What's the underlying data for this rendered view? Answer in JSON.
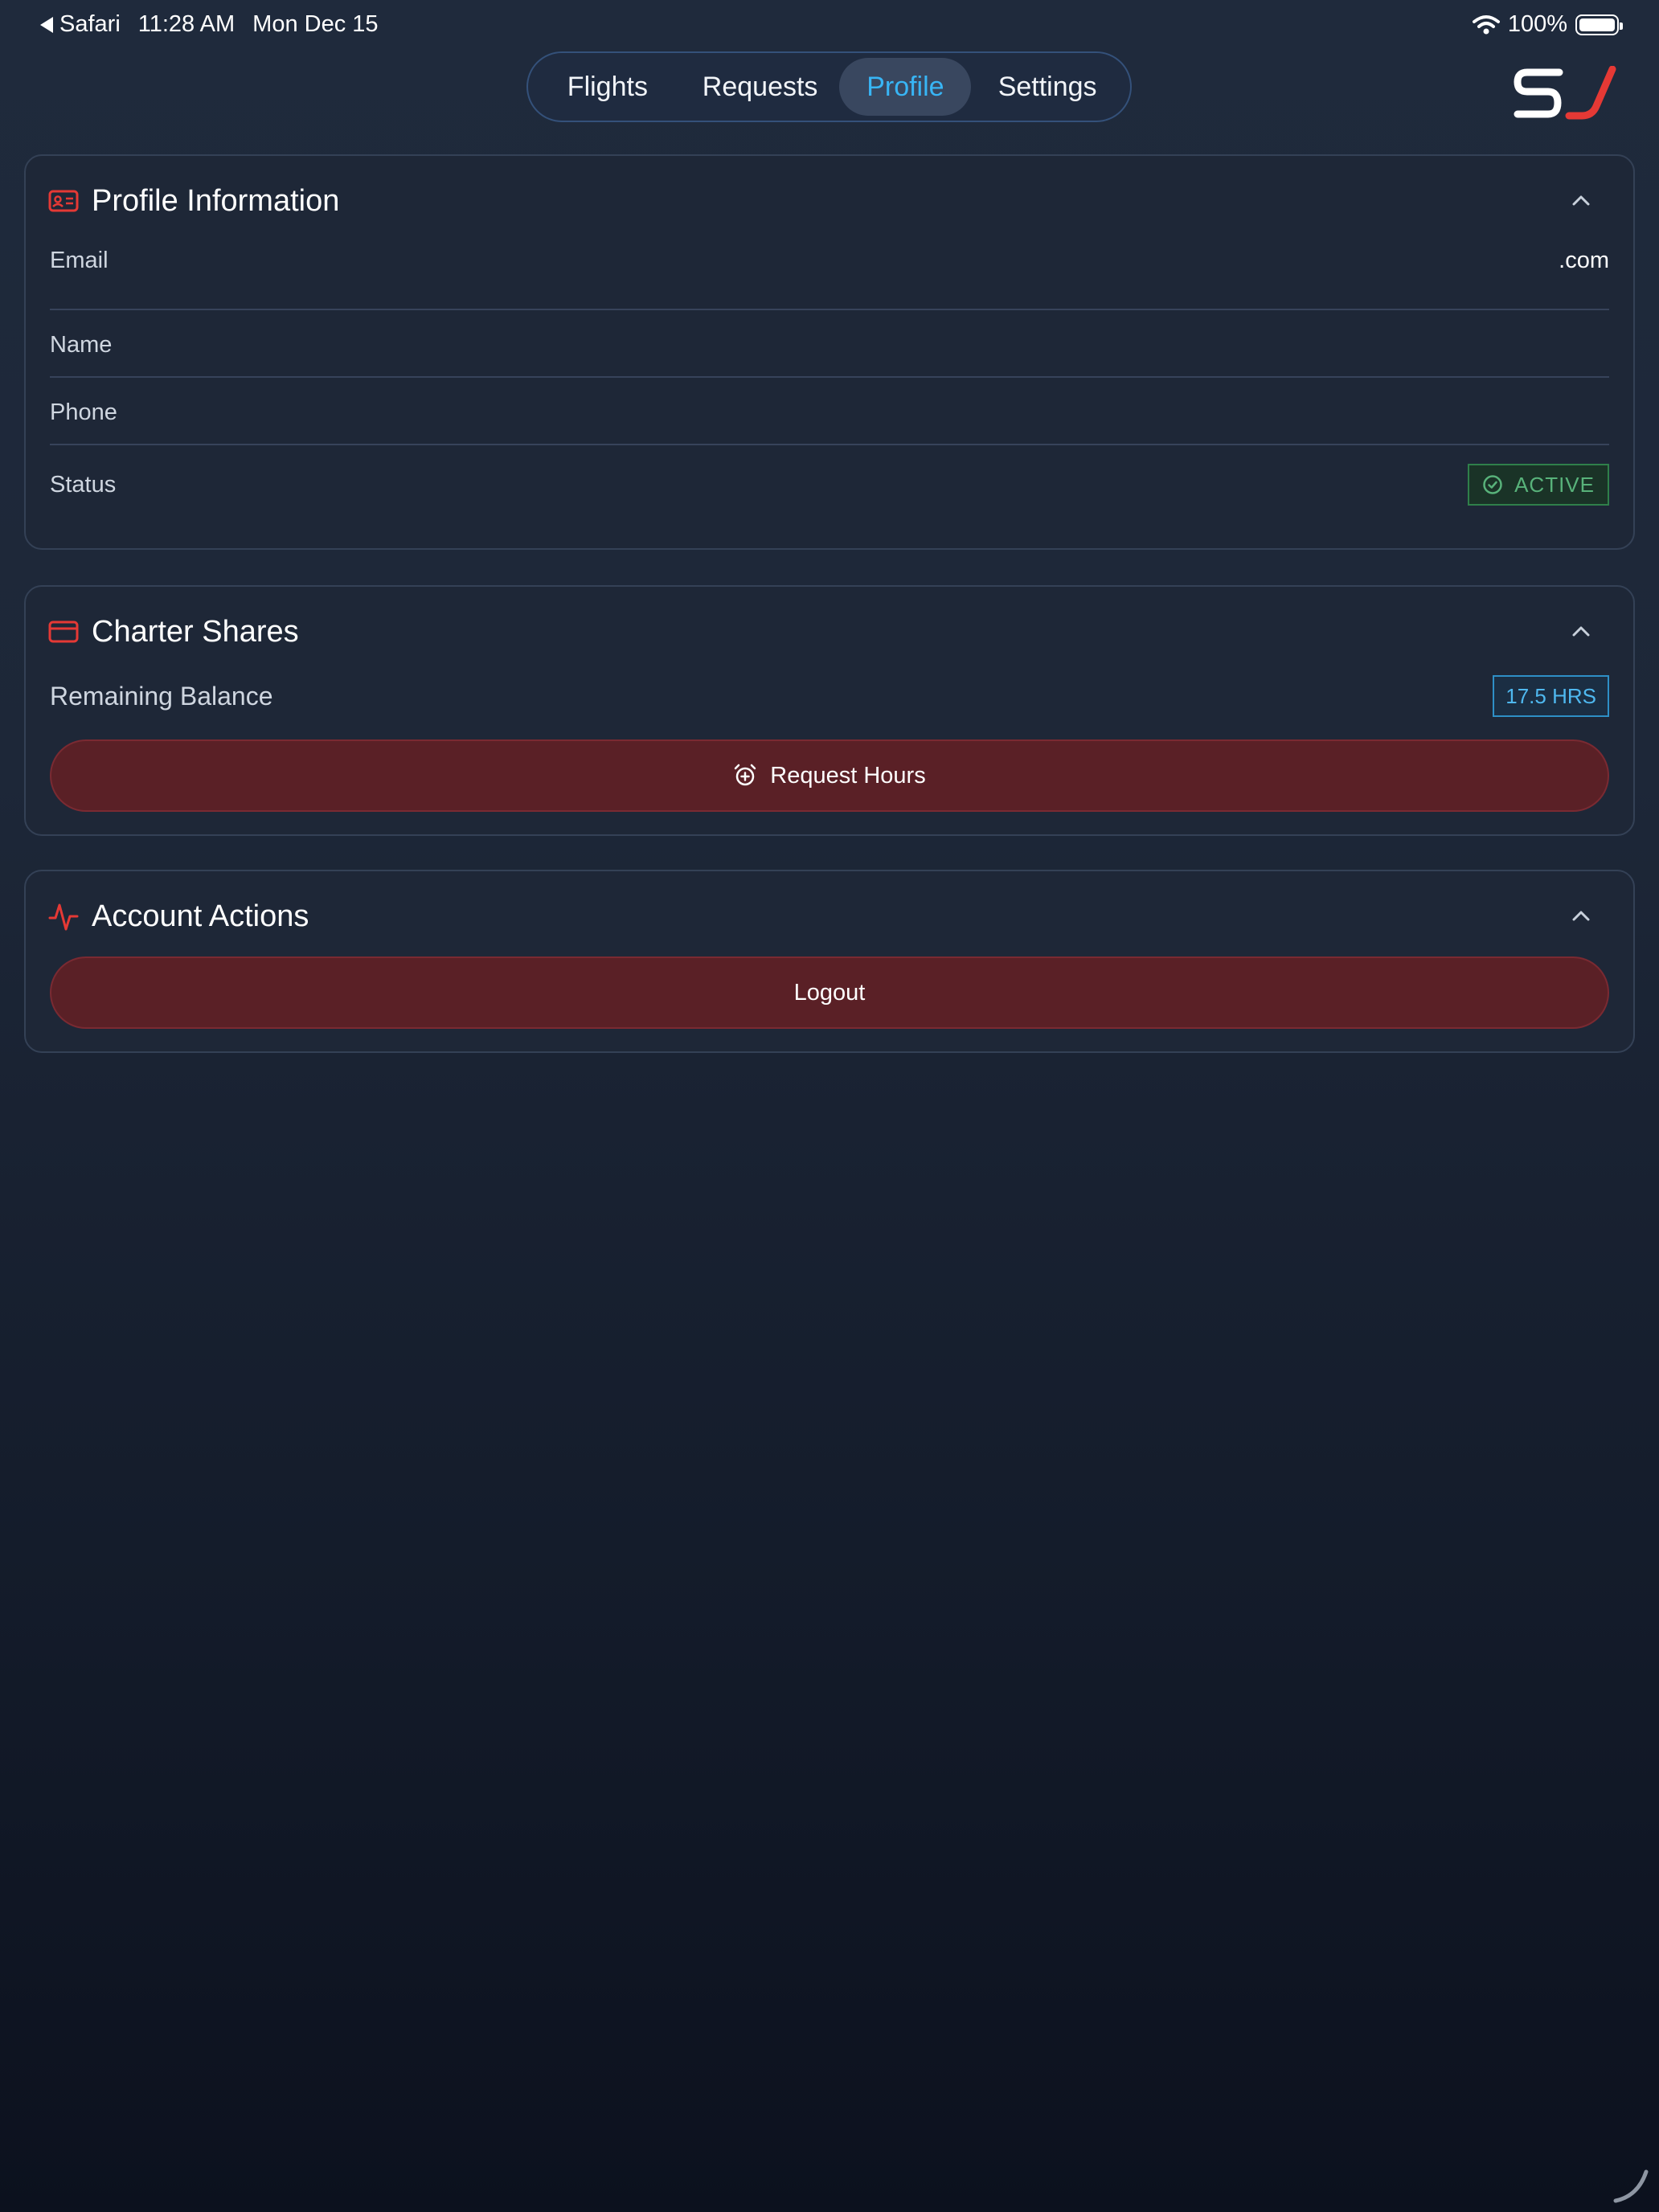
{
  "status_bar": {
    "back_app": "Safari",
    "time": "11:28 AM",
    "date": "Mon Dec 15",
    "battery": "100%"
  },
  "nav": {
    "tabs": [
      {
        "label": "Flights"
      },
      {
        "label": "Requests"
      },
      {
        "label": "Profile",
        "active": true
      },
      {
        "label": "Settings"
      }
    ]
  },
  "logo": {
    "text": "SJ",
    "colors": {
      "s": "#ffffff",
      "j": "#e53935"
    }
  },
  "profile": {
    "title": "Profile Information",
    "icon": "id-card-icon",
    "fields": {
      "email_label": "Email",
      "email_value": ".com",
      "name_label": "Name",
      "name_value": "",
      "phone_label": "Phone",
      "phone_value": "",
      "status_label": "Status",
      "status_value": "ACTIVE"
    }
  },
  "charter": {
    "title": "Charter Shares",
    "icon": "credit-card-icon",
    "balance_label": "Remaining Balance",
    "balance_value": "17.5 HRS",
    "request_button": "Request Hours"
  },
  "account": {
    "title": "Account Actions",
    "icon": "activity-icon",
    "logout_button": "Logout"
  },
  "colors": {
    "accent_red": "#e53935",
    "accent_blue": "#38b5f5",
    "active_green": "#58b27a",
    "button_red_bg": "#5a2026"
  }
}
